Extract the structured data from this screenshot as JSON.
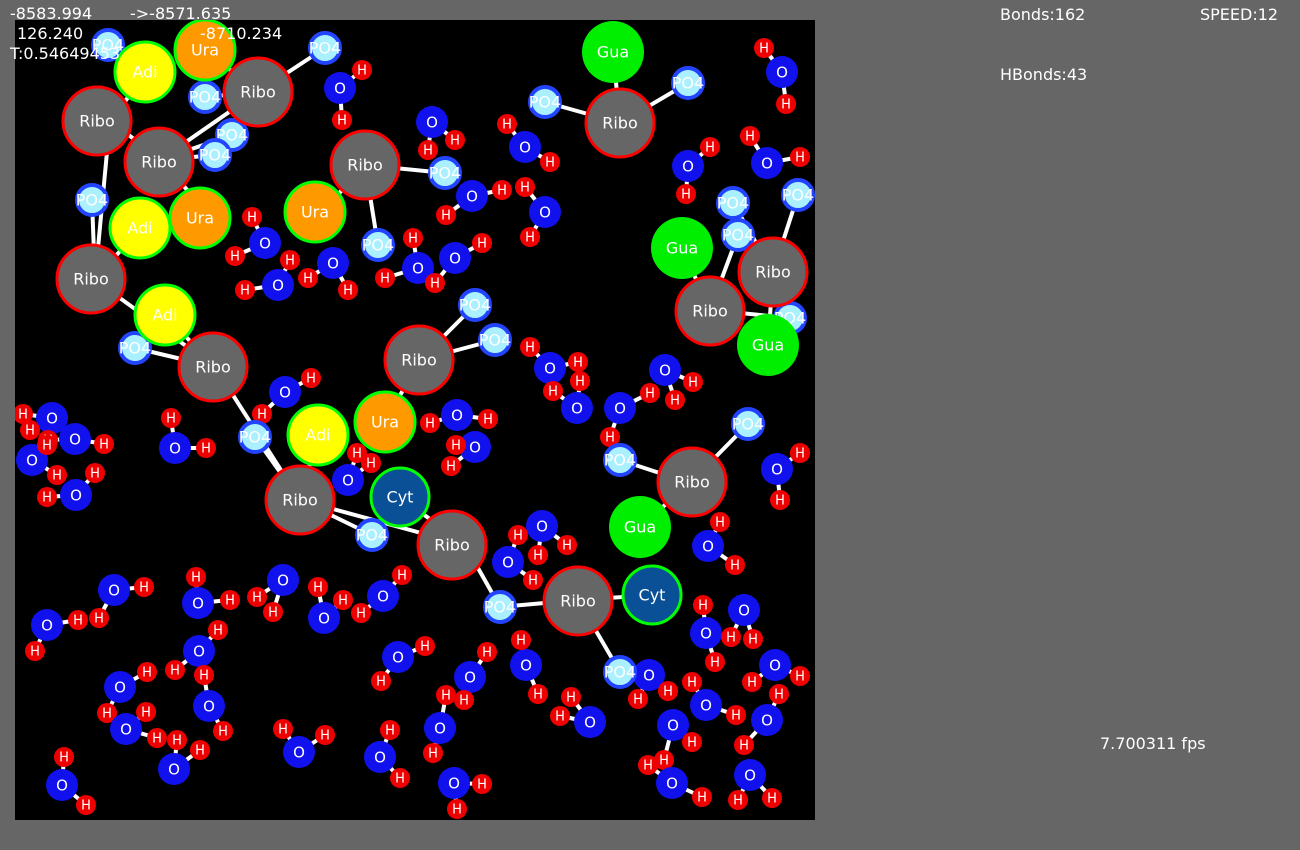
{
  "hud": {
    "coord_a": "-8583.994",
    "coord_arrow": "->-8571.635",
    "coord_b": "126.240",
    "coord_c": "-8710.234",
    "time": "T:0.54649453",
    "bonds": "Bonds:162",
    "speed": "SPEED:12",
    "hbonds": "HBonds:43",
    "fps": "7.700311 fps"
  },
  "colors": {
    "background": "#666666",
    "sim_background": "#000000",
    "ribo_fill": "#666666",
    "ribo_ring": "#ff0000",
    "ura_fill": "#ff9900",
    "adi_fill": "#ffff00",
    "gua_fill": "#00ee00",
    "cyt_fill": "#0a5096",
    "base_ring": "#00ff00",
    "po4_fill": "#aaf0ff",
    "oxygen_fill": "#1111ee",
    "hydrogen_fill": "#ee0000",
    "bond": "#ffffff"
  },
  "labels": {
    "ribo": "Ribo",
    "ura": "Ura",
    "adi": "Adi",
    "gua": "Gua",
    "cyt": "Cyt",
    "po4": "PO4",
    "oxygen": "O",
    "hydrogen": "H"
  }
}
